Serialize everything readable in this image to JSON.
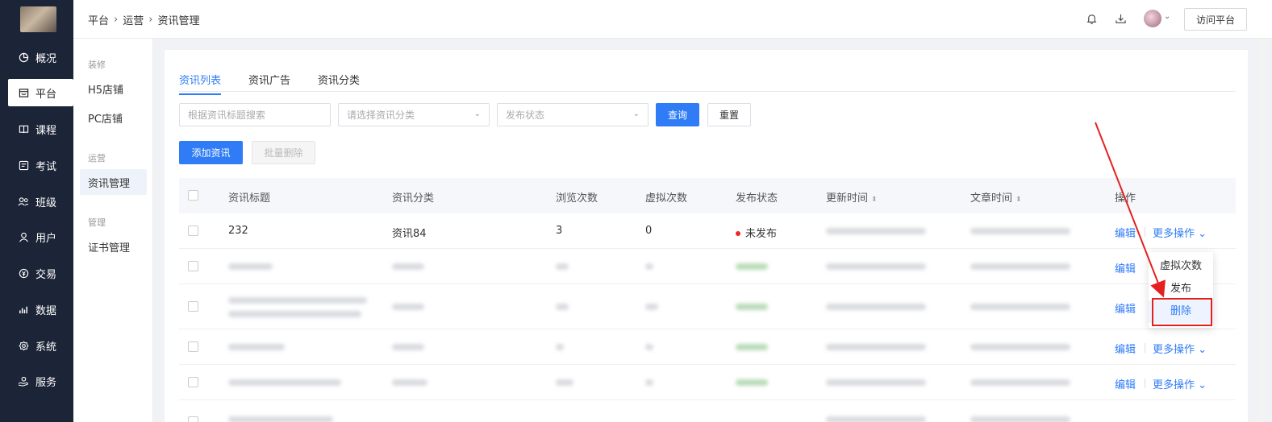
{
  "nav": {
    "items": [
      {
        "label": "概况",
        "icon": "pie-chart-icon"
      },
      {
        "label": "平台",
        "icon": "store-icon",
        "active": true
      },
      {
        "label": "课程",
        "icon": "book-icon"
      },
      {
        "label": "考试",
        "icon": "exam-icon"
      },
      {
        "label": "班级",
        "icon": "group-icon"
      },
      {
        "label": "用户",
        "icon": "user-icon"
      },
      {
        "label": "交易",
        "icon": "money-icon"
      },
      {
        "label": "数据",
        "icon": "bar-chart-icon"
      },
      {
        "label": "系统",
        "icon": "settings-icon"
      },
      {
        "label": "服务",
        "icon": "service-icon"
      }
    ]
  },
  "header": {
    "breadcrumb": [
      "平台",
      "运营",
      "资讯管理"
    ],
    "visit_label": "访问平台"
  },
  "subnav": {
    "groups": [
      {
        "title": "装修",
        "items": [
          "H5店铺",
          "PC店铺"
        ]
      },
      {
        "title": "运营",
        "items": [
          "资讯管理"
        ]
      },
      {
        "title": "管理",
        "items": [
          "证书管理"
        ]
      }
    ]
  },
  "tabs": [
    "资讯列表",
    "资讯广告",
    "资讯分类"
  ],
  "filters": {
    "search_placeholder": "根据资讯标题搜索",
    "category_placeholder": "请选择资讯分类",
    "status_placeholder": "发布状态",
    "query_label": "查询",
    "reset_label": "重置"
  },
  "actions": {
    "add_label": "添加资讯",
    "batch_delete_label": "批量删除"
  },
  "table": {
    "columns": [
      "资讯标题",
      "资讯分类",
      "浏览次数",
      "虚拟次数",
      "发布状态",
      "更新时间",
      "文章时间",
      "操作"
    ],
    "first_row": {
      "title": "232",
      "category": "资讯84",
      "views": "3",
      "virtual": "0",
      "status": "未发布"
    },
    "edit_label": "编辑",
    "more_label": "更多操作"
  },
  "dropdown": {
    "items": [
      "虚拟次数",
      "发布",
      "删除"
    ]
  },
  "colors": {
    "primary": "#2f7cf6",
    "nav_bg": "#1c2437",
    "annotation": "#e52020",
    "status_unpublished": "#f5222d"
  }
}
